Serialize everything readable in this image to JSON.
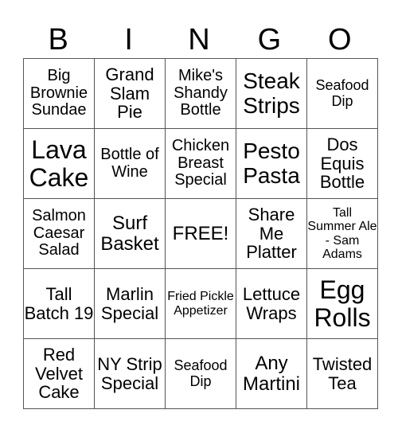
{
  "header": {
    "letters": [
      "B",
      "I",
      "N",
      "G",
      "O"
    ]
  },
  "rows": [
    [
      "Big Brownie Sundae",
      "Grand Slam Pie",
      "Mike's Shandy Bottle",
      "Steak Strips",
      "Seafood Dip"
    ],
    [
      "Lava Cake",
      "Bottle of Wine",
      "Chicken Breast Special",
      "Pesto Pasta",
      "Dos Equis Bottle"
    ],
    [
      "Salmon Caesar Salad",
      "Surf Basket",
      "FREE!",
      "Share Me Platter",
      "Tall Summer Ale - Sam Adams"
    ],
    [
      "Tall Batch 19",
      "Marlin Special",
      "Fried Pickle Appetizer",
      "Lettuce Wraps",
      "Egg Rolls"
    ],
    [
      "Red Velvet Cake",
      "NY Strip Special",
      "Seafood Dip",
      "Any Martini",
      "Twisted Tea"
    ]
  ]
}
